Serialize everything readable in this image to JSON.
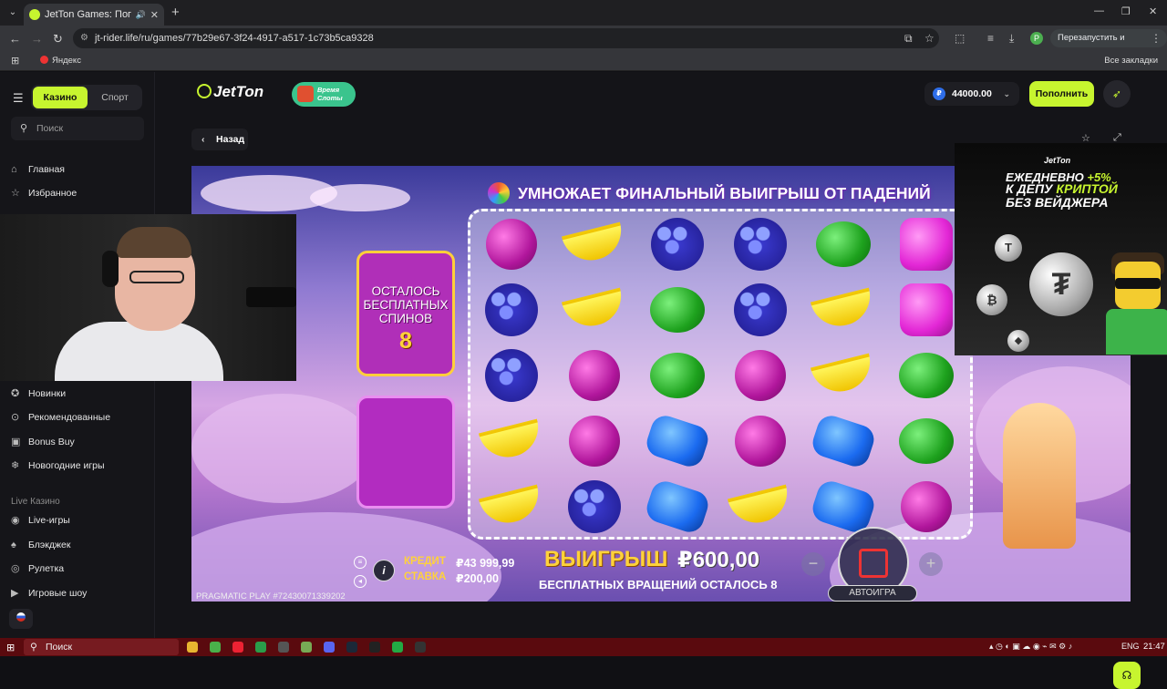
{
  "browser": {
    "tab_title": "JetTon Games: Погружение",
    "url": "jt-rider.life/ru/games/77b29e67-3f24-4917-a517-1c73b5ca9328",
    "relaunch_label": "Перезапустить и обновить",
    "bookmark_yandex": "Яндекс",
    "all_bookmarks": "Все закладки",
    "profile_initial": "P"
  },
  "sidebar": {
    "casino_tab": "Казино",
    "sport_tab": "Спорт",
    "search_placeholder": "Поиск",
    "items_top": [
      {
        "label": "Главная",
        "icon": "home-icon"
      },
      {
        "label": "Избранное",
        "icon": "star-icon"
      }
    ],
    "items_mid": [
      {
        "label": "Новинки",
        "icon": "new-icon"
      },
      {
        "label": "Рекомендованные",
        "icon": "recommended-icon"
      },
      {
        "label": "Bonus Buy",
        "icon": "bonus-buy-icon"
      },
      {
        "label": "Новогодние игры",
        "icon": "snowflake-icon"
      }
    ],
    "live_section": "Live Казино",
    "items_live": [
      {
        "label": "Live-игры",
        "icon": "live-icon"
      },
      {
        "label": "Блэкджек",
        "icon": "cards-icon"
      },
      {
        "label": "Рулетка",
        "icon": "roulette-icon"
      },
      {
        "label": "Игровые шоу",
        "icon": "show-icon"
      }
    ]
  },
  "header": {
    "logo": "JetTon",
    "promo": "Время Слоты",
    "balance": "44000.00",
    "currency_symbol": "₽",
    "deposit_label": "Пополнить",
    "back_label": "Назад"
  },
  "game": {
    "banner": "УМНОЖАЕТ ФИНАЛЬНЫЙ ВЫИГРЫШ ОТ ПАДЕНИЙ",
    "spins_label": "ОСТАЛОСЬ БЕСПЛАТНЫХ СПИНОВ",
    "spins_count": "8",
    "credit_label": "КРЕДИТ",
    "credit_value": "₽43 999,99",
    "stake_label": "СТАВКА",
    "stake_value": "₽200,00",
    "win_label": "ВЫИГРЫШ",
    "win_value": "₽600,00",
    "free_spins_left": "БЕСПЛАТНЫХ ВРАЩЕНИЙ ОСТАЛОСЬ 8",
    "autoplay_label": "АВТОИГРА",
    "provider": "PRAGMATIC PLAY",
    "round_id": "#72430071339202",
    "reels": [
      [
        "plum",
        "grape",
        "grape",
        "banana",
        "banana"
      ],
      [
        "banana",
        "banana",
        "plum",
        "plum",
        "grape"
      ],
      [
        "grape",
        "melon",
        "melon",
        "blue",
        "blue"
      ],
      [
        "grape",
        "grape",
        "plum",
        "plum",
        "banana"
      ],
      [
        "melon",
        "banana",
        "banana",
        "blue",
        "blue"
      ],
      [
        "square",
        "square",
        "melon",
        "melon",
        "plum"
      ]
    ]
  },
  "ad": {
    "brand": "JetTon",
    "line1_a": "ЕЖЕДНЕВНО",
    "line1_b": "+5%",
    "line2_a": "К ДЕПУ",
    "line2_b": "КРИПТОЙ",
    "line3": "БЕЗ ВЕЙДЖЕРА"
  },
  "taskbar": {
    "search": "Поиск",
    "lang": "ENG",
    "time": "21:47"
  }
}
